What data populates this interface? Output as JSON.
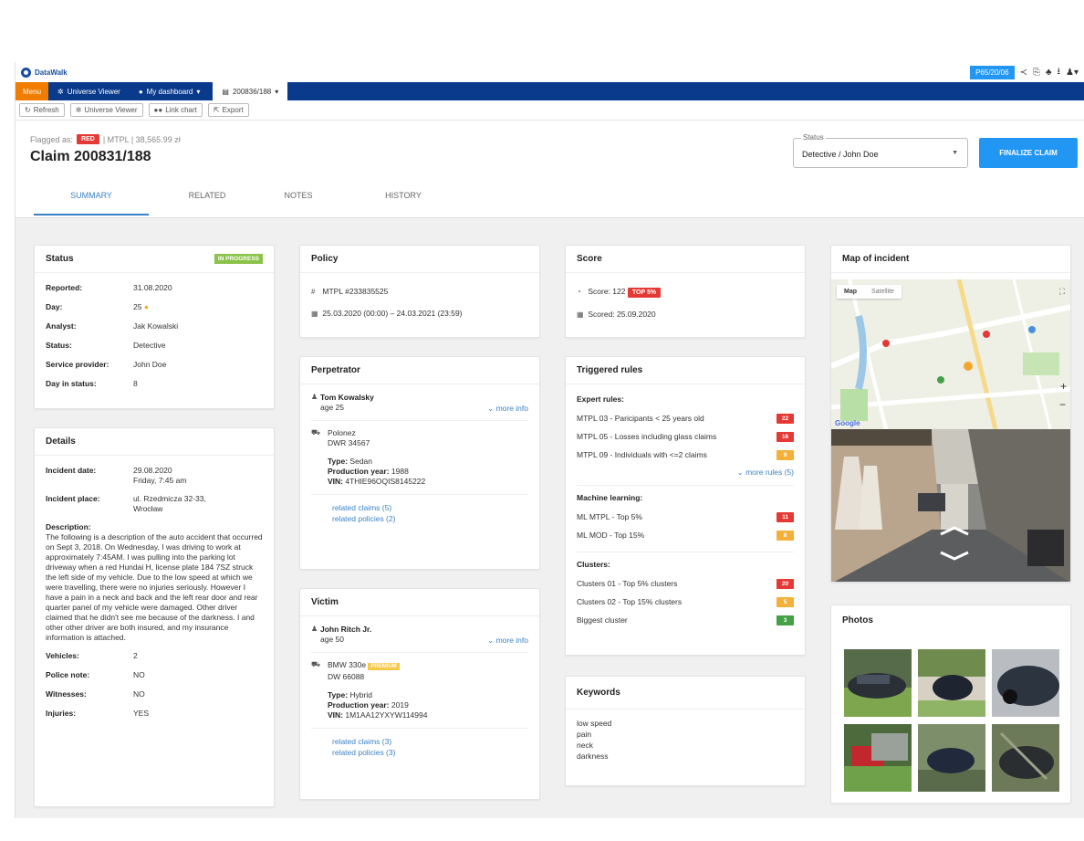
{
  "app": {
    "name": "DataWalk"
  },
  "topbar": {
    "date": "P65/20/06",
    "icons": [
      "share-icon",
      "copy-icon",
      "bell-icon",
      "download-icon",
      "user-icon"
    ]
  },
  "tabbar": {
    "menu": "Menu",
    "tabs": [
      {
        "label": "Universe Viewer"
      },
      {
        "label": "My dashboard"
      },
      {
        "label": "200836/188"
      }
    ]
  },
  "toolbar": {
    "refresh": "Refresh",
    "universe_viewer": "Universe Viewer",
    "link_chart": "Link chart",
    "export": "Export"
  },
  "header": {
    "flagged_prefix": "Flagged as:",
    "flag_badge": "RED",
    "flag_info": "| MTPL | 38,565.99 zł",
    "title": "Claim 200831/188",
    "status_label": "Status",
    "status_value": "Detective / John Doe",
    "finalize": "FINALIZE CLAIM",
    "tabs": [
      "SUMMARY",
      "RELATED",
      "NOTES",
      "HISTORY"
    ]
  },
  "status_card": {
    "title": "Status",
    "badge": "IN PROGRESS",
    "rows": [
      {
        "k": "Reported:",
        "v": "31.08.2020"
      },
      {
        "k": "Day:",
        "v": "25"
      },
      {
        "k": "Analyst:",
        "v": "Jak Kowalski"
      },
      {
        "k": "Status:",
        "v": "Detective"
      },
      {
        "k": "Service provider:",
        "v": "John Doe"
      },
      {
        "k": "Day in status:",
        "v": "8"
      }
    ]
  },
  "details_card": {
    "title": "Details",
    "incident_date_k": "Incident date:",
    "incident_date_v1": "29.08.2020",
    "incident_date_v2": "Friday, 7:45 am",
    "incident_place_k": "Incident place:",
    "incident_place_v1": "ul. Rzedmicza 32-33,",
    "incident_place_v2": "Wrocław",
    "description_k": "Description:",
    "description": "The following is a description of the auto accident that occurred on Sept 3, 2018. On Wednesday, I was driving to work at approximately 7:45AM. I was pulling into the parking lot driveway when a red Hundai H, license plate 184 7SZ struck the left side of my vehicle. Due to the low speed at which we were travelling, there were no injuries seriously. However I have a pain in a neck and back and the left rear door and rear quarter panel of my vehicle were damaged. Other driver claimed that he didn't see me because of the darkness. I and other other driver are both insured, and my insurance information is attached.",
    "rows": [
      {
        "k": "Vehicles:",
        "v": "2"
      },
      {
        "k": "Police note:",
        "v": "NO"
      },
      {
        "k": "Witnesses:",
        "v": "NO"
      },
      {
        "k": "Injuries:",
        "v": "YES"
      }
    ]
  },
  "policy_card": {
    "title": "Policy",
    "number": "MTPL #233835525",
    "period": "25.03.2020 (00:00) – 24.03.2021 (23:59)"
  },
  "perpetrator_card": {
    "title": "Perpetrator",
    "name": "Tom Kowalsky",
    "age": "age 25",
    "more": "more info",
    "car": "Polonez",
    "plate": "DWR 34567",
    "type_k": "Type:",
    "type_v": "Sedan",
    "year_k": "Production year:",
    "year_v": "1988",
    "vin_k": "VIN:",
    "vin_v": "4THIE96OQIS8145222",
    "related_claims": "related claims (5)",
    "related_policies": "related policies (2)"
  },
  "victim_card": {
    "title": "Victim",
    "name": "John Ritch Jr.",
    "age": "age 50",
    "more": "more info",
    "car": "BMW 330e",
    "car_badge": "PREMIUM",
    "plate": "DW 66088",
    "type_k": "Type:",
    "type_v": "Hybrid",
    "year_k": "Production year:",
    "year_v": "2019",
    "vin_k": "VIN:",
    "vin_v": "1M1AA12YXYW114994",
    "related_claims": "related claims (3)",
    "related_policies": "related policies (3)"
  },
  "score_card": {
    "title": "Score",
    "score": "Score: 122",
    "score_badge": "TOP 5%",
    "scored": "Scored: 25.09.2020"
  },
  "rules_card": {
    "title": "Triggered rules",
    "expert_title": "Expert rules:",
    "expert": [
      {
        "label": "MTPL 03 - Paricipants < 25 years old",
        "count": "22",
        "color": "#e53935"
      },
      {
        "label": "MTPL 05 - Losses including glass claims",
        "count": "16",
        "color": "#e53935"
      },
      {
        "label": "MTPL 09 - Individuals with <=2 claims",
        "count": "9",
        "color": "#f3b13a"
      }
    ],
    "more_rules": "more rules (5)",
    "ml_title": "Machine learning:",
    "ml": [
      {
        "label": "ML MTPL - Top 5%",
        "count": "11",
        "color": "#e53935"
      },
      {
        "label": "ML MOD - Top 15%",
        "count": "8",
        "color": "#f3b13a"
      }
    ],
    "clusters_title": "Clusters:",
    "clusters": [
      {
        "label": "Clusters 01 - Top 5% clusters",
        "count": "20",
        "color": "#e53935"
      },
      {
        "label": "Clusters 02 - Top 15% clusters",
        "count": "5",
        "color": "#f3b13a"
      },
      {
        "label": "Biggest cluster",
        "count": "3",
        "color": "#43a047"
      }
    ]
  },
  "keywords_card": {
    "title": "Keywords",
    "items": [
      "low speed",
      "pain",
      "neck",
      "darkness"
    ]
  },
  "map_card": {
    "title": "Map of incident",
    "map_btn": "Map",
    "satellite_btn": "Satellite",
    "brand": "Google"
  },
  "photos_card": {
    "title": "Photos"
  }
}
